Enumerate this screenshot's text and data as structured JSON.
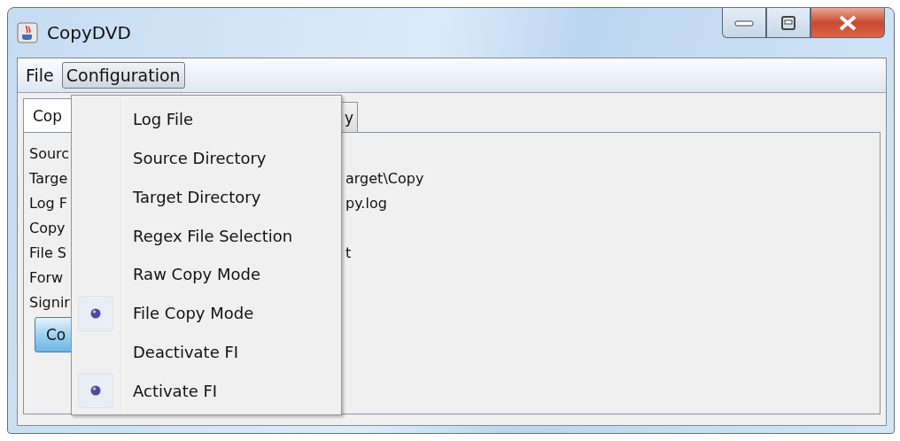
{
  "window": {
    "title": "CopyDVD"
  },
  "menubar": [
    {
      "label": "File",
      "selected": false
    },
    {
      "label": "Configuration",
      "selected": true
    }
  ],
  "tabs": [
    {
      "label": "Cop",
      "selected": true
    },
    {
      "label": "y",
      "selected": false
    }
  ],
  "rows": [
    {
      "label": "Sourc"
    },
    {
      "label": "Targe",
      "value": "arget\\Copy"
    },
    {
      "label": "Log F",
      "value": "py.log"
    },
    {
      "label": "Copy"
    },
    {
      "label": "File S",
      "value": "t"
    },
    {
      "label": "Forw"
    },
    {
      "label": "Signir"
    }
  ],
  "button": {
    "label": "Co"
  },
  "menu": [
    {
      "label": "Log File",
      "selected": false
    },
    {
      "label": "Source Directory",
      "selected": false
    },
    {
      "label": "Target Directory",
      "selected": false
    },
    {
      "label": "Regex File Selection",
      "selected": false
    },
    {
      "label": "Raw Copy Mode",
      "selected": false
    },
    {
      "label": "File Copy Mode",
      "selected": true
    },
    {
      "label": "Deactivate FI",
      "selected": false
    },
    {
      "label": "Activate FI",
      "selected": true
    }
  ]
}
